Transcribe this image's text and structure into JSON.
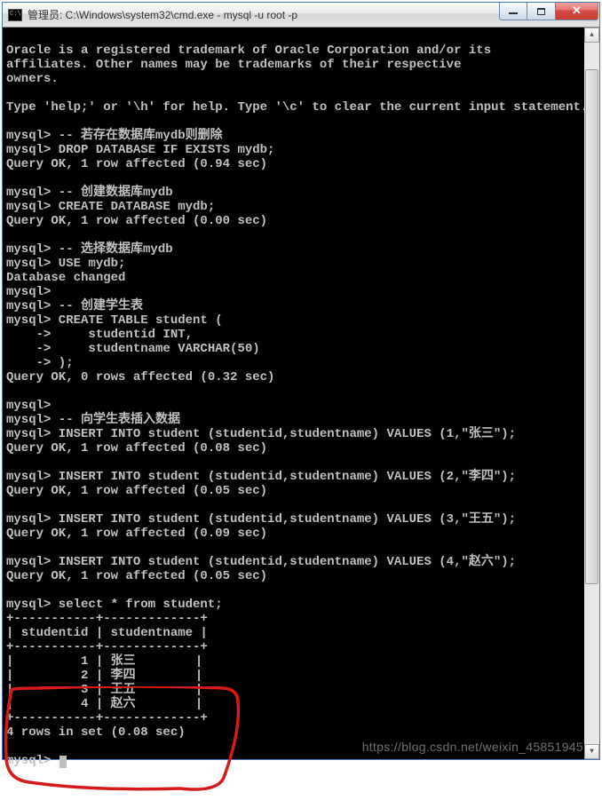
{
  "window": {
    "title": "管理员: C:\\Windows\\system32\\cmd.exe - mysql  -u root -p"
  },
  "terminal": {
    "lines": [
      "",
      "Oracle is a registered trademark of Oracle Corporation and/or its",
      "affiliates. Other names may be trademarks of their respective",
      "owners.",
      "",
      "Type 'help;' or '\\h' for help. Type '\\c' to clear the current input statement.",
      "",
      "mysql> -- 若存在数据库mydb则删除",
      "mysql> DROP DATABASE IF EXISTS mydb;",
      "Query OK, 1 row affected (0.94 sec)",
      "",
      "mysql> -- 创建数据库mydb",
      "mysql> CREATE DATABASE mydb;",
      "Query OK, 1 row affected (0.00 sec)",
      "",
      "mysql> -- 选择数据库mydb",
      "mysql> USE mydb;",
      "Database changed",
      "mysql>",
      "mysql> -- 创建学生表",
      "mysql> CREATE TABLE student (",
      "    ->     studentid INT,",
      "    ->     studentname VARCHAR(50)",
      "    -> );",
      "Query OK, 0 rows affected (0.32 sec)",
      "",
      "mysql>",
      "mysql> -- 向学生表插入数据",
      "mysql> INSERT INTO student (studentid,studentname) VALUES (1,\"张三\");",
      "Query OK, 1 row affected (0.08 sec)",
      "",
      "mysql> INSERT INTO student (studentid,studentname) VALUES (2,\"李四\");",
      "Query OK, 1 row affected (0.05 sec)",
      "",
      "mysql> INSERT INTO student (studentid,studentname) VALUES (3,\"王五\");",
      "Query OK, 1 row affected (0.09 sec)",
      "",
      "mysql> INSERT INTO student (studentid,studentname) VALUES (4,\"赵六\");",
      "Query OK, 1 row affected (0.05 sec)",
      "",
      "mysql> select * from student;",
      "+-----------+-------------+",
      "| studentid | studentname |",
      "+-----------+-------------+",
      "|         1 | 张三        |",
      "|         2 | 李四        |",
      "|         3 | 王五        |",
      "|         4 | 赵六        |",
      "+-----------+-------------+",
      "4 rows in set (0.08 sec)",
      "",
      "mysql> "
    ]
  },
  "query_result": {
    "columns": [
      "studentid",
      "studentname"
    ],
    "rows": [
      {
        "studentid": 1,
        "studentname": "张三"
      },
      {
        "studentid": 2,
        "studentname": "李四"
      },
      {
        "studentid": 3,
        "studentname": "王五"
      },
      {
        "studentid": 4,
        "studentname": "赵六"
      }
    ],
    "summary": "4 rows in set (0.08 sec)"
  },
  "watermark": "https://blog.csdn.net/weixin_45851945"
}
